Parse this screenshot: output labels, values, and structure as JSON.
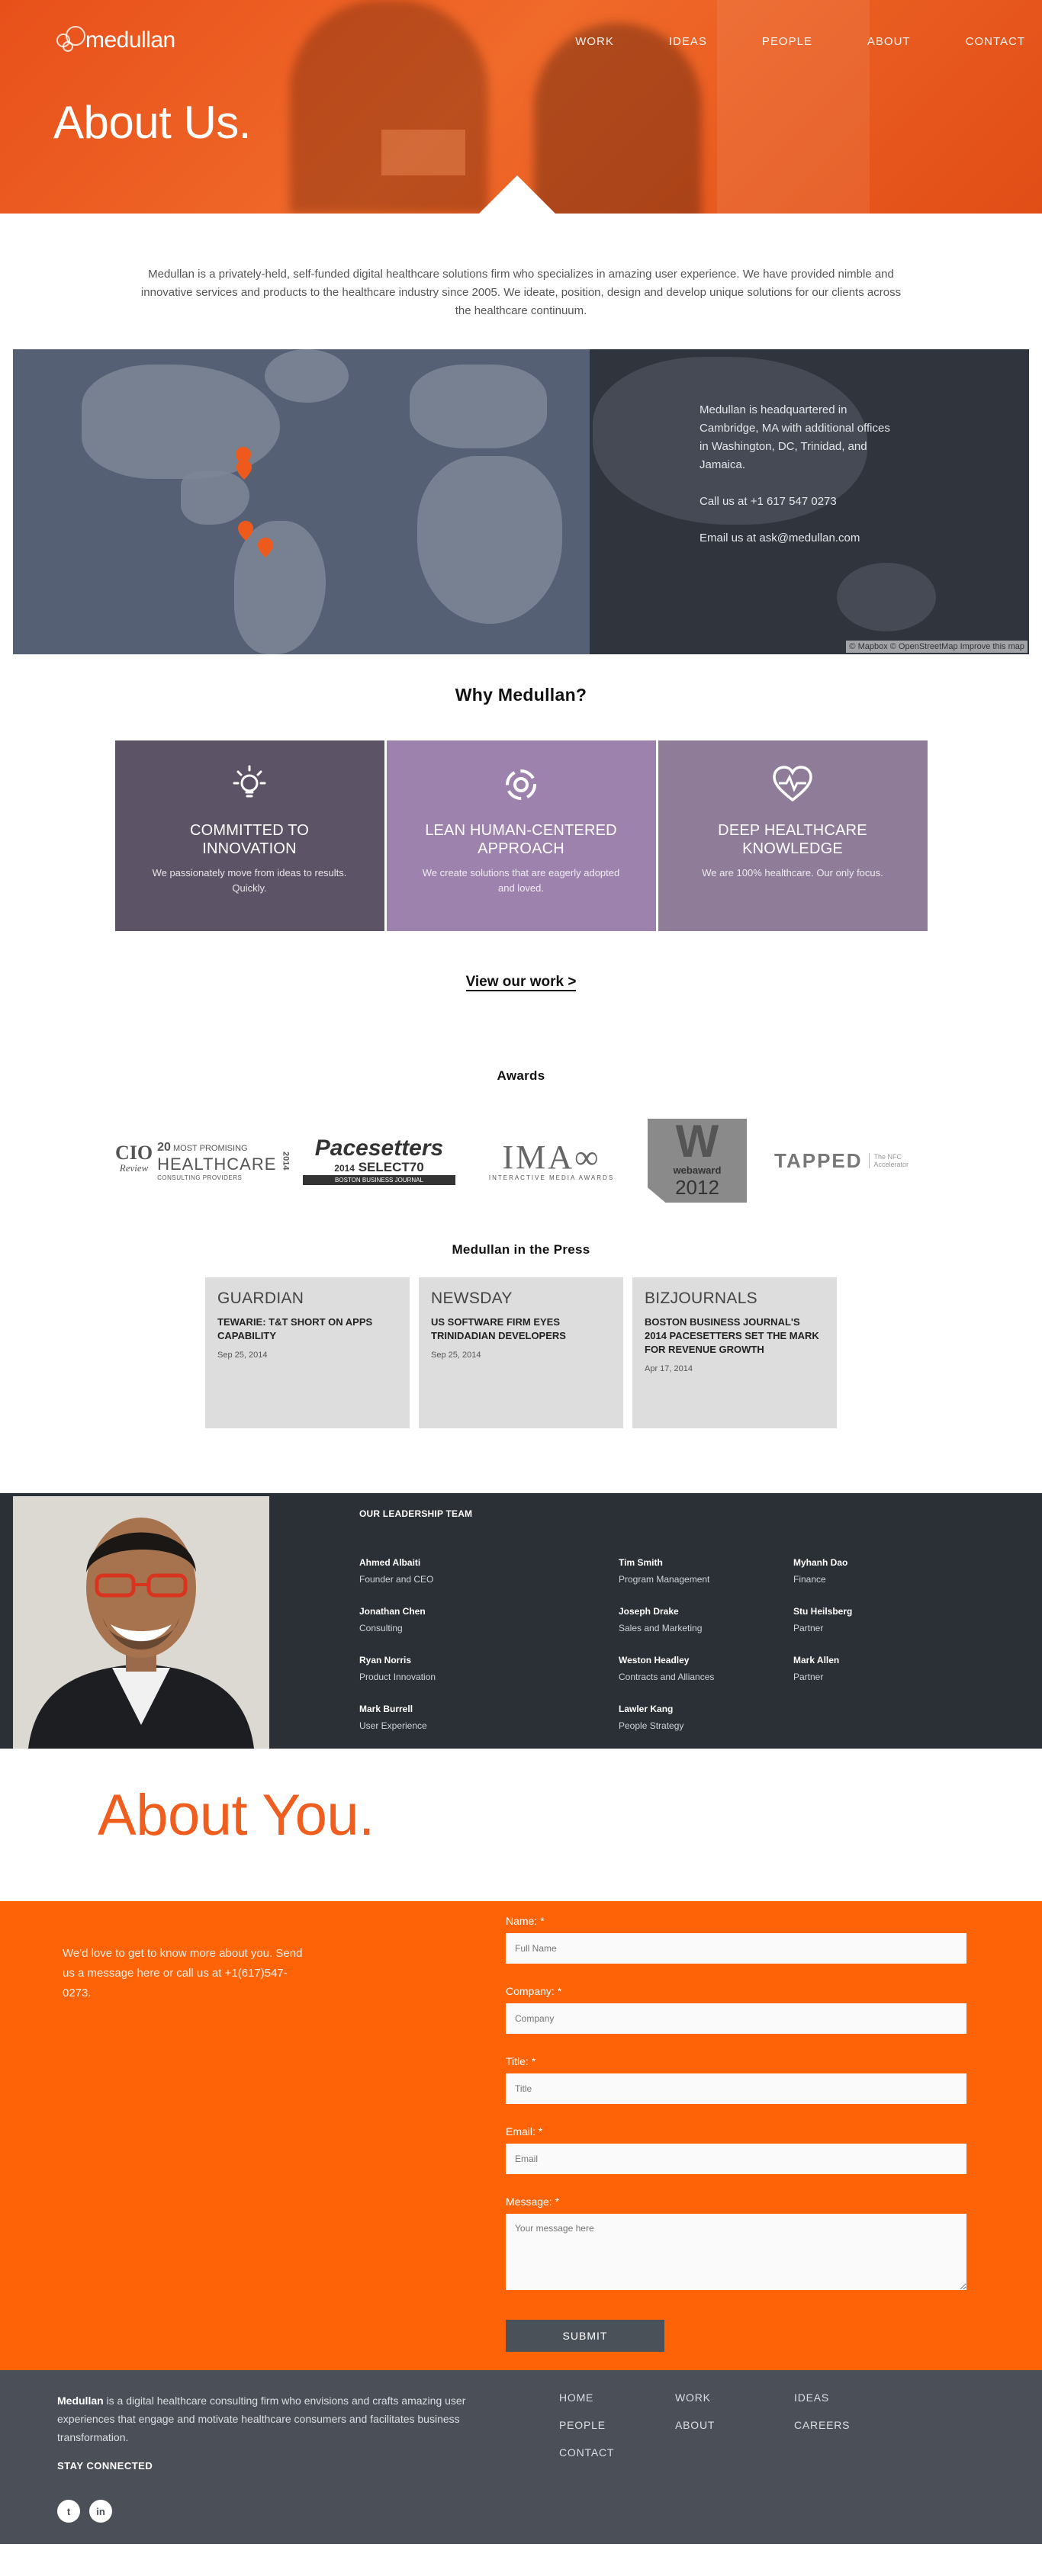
{
  "brand": {
    "name": "medullan"
  },
  "nav": [
    "WORK",
    "IDEAS",
    "PEOPLE",
    "ABOUT",
    "CONTACT"
  ],
  "hero": {
    "title": "About Us."
  },
  "intro": "Medullan is a privately-held, self-funded digital healthcare solutions firm who specializes in amazing user experience. We have provided nimble and innovative services and products to the healthcare industry since 2005. We ideate, position, design and develop unique solutions for our clients across the healthcare continuum.",
  "map": {
    "hq": "Medullan is headquartered in Cambridge, MA with additional offices in Washington, DC, Trinidad, and Jamaica.",
    "phone": "Call us at +1 617 547 0273",
    "email": "Email us at ask@medullan.com",
    "credit": "© Mapbox © OpenStreetMap Improve this map"
  },
  "why": {
    "title": "Why Medullan?",
    "cards": [
      {
        "title": "COMMITTED TO INNOVATION",
        "text": "We passionately move from ideas to results. Quickly.",
        "icon": "lightbulb-icon"
      },
      {
        "title": "LEAN HUMAN-CENTERED APPROACH",
        "text": "We create solutions that are eagerly adopted and loved.",
        "icon": "cycle-icon"
      },
      {
        "title": "DEEP HEALTHCARE KNOWLEDGE",
        "text": "We are 100% healthcare. Our only focus.",
        "icon": "heart-pulse-icon"
      }
    ],
    "cta": "View our work >"
  },
  "awards": {
    "title": "Awards",
    "logos": {
      "cio": {
        "a": "CIO",
        "b": "Review",
        "c": "20",
        "d": "MOST PROMISING",
        "e": "HEALTHCARE",
        "f": "CONSULTING PROVIDERS",
        "g": "2014"
      },
      "pace": {
        "a": "Pacesetters",
        "b": "2014",
        "c": "SELECT70",
        "d": "BOSTON BUSINESS JOURNAL"
      },
      "ima": {
        "a": "IMA",
        "b": "INTERACTIVE MEDIA AWARDS"
      },
      "web": {
        "a": "W",
        "b": "webaward",
        "c": "2012"
      },
      "tapped": {
        "a": "TAPPED",
        "b": "The NFC Accelerator"
      }
    }
  },
  "press": {
    "title": "Medullan in the Press",
    "items": [
      {
        "source": "GUARDIAN",
        "headline": "TEWARIE: T&T SHORT ON APPS CAPABILITY",
        "date": "Sep 25, 2014"
      },
      {
        "source": "NEWSDAY",
        "headline": "US SOFTWARE FIRM EYES TRINIDADIAN DEVELOPERS",
        "date": "Sep 25, 2014"
      },
      {
        "source": "BIZJOURNALS",
        "headline": "BOSTON BUSINESS JOURNAL'S 2014 PACESETTERS SET THE MARK FOR REVENUE GROWTH",
        "date": "Apr 17, 2014"
      }
    ]
  },
  "leadership": {
    "title": "OUR LEADERSHIP TEAM",
    "people": [
      {
        "name": "Ahmed Albaiti",
        "role": "Founder and CEO"
      },
      {
        "name": "Jonathan Chen",
        "role": "Consulting"
      },
      {
        "name": "Ryan Norris",
        "role": "Product Innovation"
      },
      {
        "name": "Mark Burrell",
        "role": "User Experience"
      },
      {
        "name": "Tim Smith",
        "role": "Program Management"
      },
      {
        "name": "Joseph Drake",
        "role": "Sales and Marketing"
      },
      {
        "name": "Weston Headley",
        "role": "Contracts and Alliances"
      },
      {
        "name": "Lawler Kang",
        "role": "People Strategy"
      },
      {
        "name": "Myhanh Dao",
        "role": "Finance"
      },
      {
        "name": "Stu Heilsberg",
        "role": "Partner"
      },
      {
        "name": "Mark Allen",
        "role": "Partner"
      }
    ]
  },
  "about_you": {
    "title": "About You.",
    "message": "We'd love to get to know more about you. Send us a message here or call us at +1(617)547-0273.",
    "form": {
      "name_label": "Name: *",
      "name_ph": "Full Name",
      "company_label": "Company: *",
      "company_ph": "Company",
      "title_label": "Title: *",
      "title_ph": "Title",
      "email_label": "Email: *",
      "email_ph": "Email",
      "message_label": "Message: *",
      "message_ph": "Your message here",
      "submit": "SUBMIT"
    }
  },
  "footer": {
    "brand": "Medullan",
    "about": " is a digital healthcare consulting firm who envisions and crafts amazing user experiences that engage and motivate healthcare consumers and facilitates business transformation.",
    "stay": "STAY CONNECTED",
    "social": [
      {
        "icon": "twitter-icon",
        "label": "t"
      },
      {
        "icon": "linkedin-icon",
        "label": "in"
      }
    ],
    "links": [
      "HOME",
      "WORK",
      "IDEAS",
      "PEOPLE",
      "ABOUT",
      "CAREERS",
      "CONTACT"
    ]
  },
  "colors": {
    "brand_orange": "#fe6307",
    "dark": "#2b2f36",
    "purple": "#9d82ad"
  }
}
